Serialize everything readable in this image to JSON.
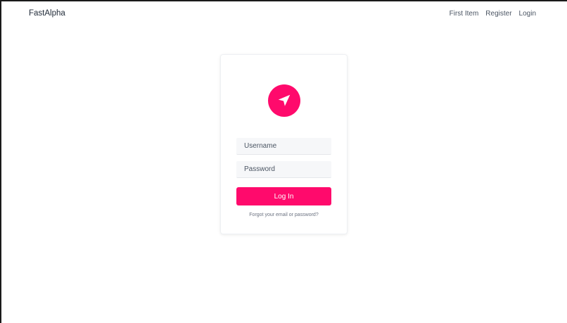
{
  "navbar": {
    "brand": "FastAlpha",
    "links": [
      "First Item",
      "Register",
      "Login"
    ]
  },
  "login_card": {
    "logo_icon": "navigation-arrow-icon",
    "username": {
      "placeholder": "Username",
      "value": ""
    },
    "password": {
      "placeholder": "Password",
      "value": ""
    },
    "submit_label": "Log In",
    "forgot_link": "Forgot your email or password?"
  },
  "colors": {
    "accent": "#ff0a6c",
    "input_bg": "#f6f7f9",
    "text": "#1f2937"
  }
}
